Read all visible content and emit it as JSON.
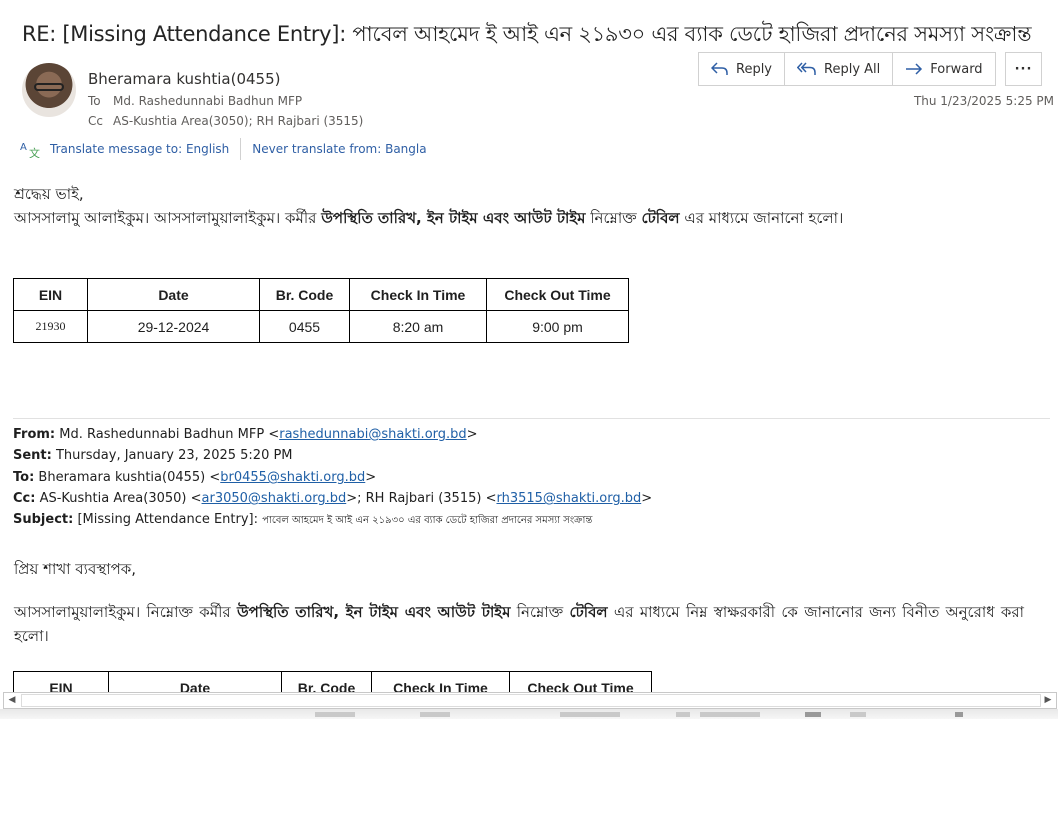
{
  "email": {
    "subject": "RE: [Missing Attendance Entry]: পাবেল আহমেদ ই আই এন ২১৯৩০ এর ব্যাক ডেটে হাজিরা প্রদানের সমস্যা সংক্রান্ত",
    "sender": "Bheramara kushtia(0455)",
    "to_label": "To",
    "to": "Md. Rashedunnabi Badhun MFP",
    "cc_label": "Cc",
    "cc": "AS-Kushtia Area(3050); RH Rajbari (3515)",
    "date": "Thu 1/23/2025 5:25 PM"
  },
  "toolbar": {
    "reply": "Reply",
    "reply_all": "Reply All",
    "forward": "Forward",
    "more": "···"
  },
  "translate": {
    "translate_link": "Translate message to: English",
    "never_link": "Never translate from: Bangla"
  },
  "body": {
    "greeting": "শ্রদ্ধেয় ভাই,",
    "para_a": "আসসালামু আলাইকুম। আসসালামুয়ালাইকুম।  কর্মীর ",
    "para_b": "উপস্থিতি তারিখ, ইন টাইম এবং আউট টাইম",
    "para_c": " নিম্নোক্ত ",
    "para_d": "টেবিল",
    "para_e": " এর মাধ্যমে জানানো হলো।",
    "table": {
      "headers": [
        "EIN",
        "Date",
        "Br. Code",
        "Check In Time",
        "Check Out Time"
      ],
      "row": [
        "21930",
        "29-12-2024",
        "0455",
        "8:20 am",
        "9:00 pm"
      ]
    }
  },
  "quoted": {
    "from_label": "From:",
    "from_name": " Md. Rashedunnabi Badhun MFP <",
    "from_email": "rashedunnabi@shakti.org.bd",
    "sent_label": "Sent:",
    "sent": " Thursday, January 23, 2025 5:20 PM",
    "to_label": "To:",
    "to_name": " Bheramara kushtia(0455) <",
    "to_email": "br0455@shakti.org.bd",
    "cc_label": "Cc:",
    "cc_name1": " AS-Kushtia Area(3050) <",
    "cc_email1": "ar3050@shakti.org.bd",
    "cc_name2": ">; RH Rajbari (3515) <",
    "cc_email2": "rh3515@shakti.org.bd",
    "subject_label": "Subject:",
    "subject_en": " [Missing Attendance Entry]: ",
    "subject_bn": "পাবেল আহমেদ ই আই এন ২১৯৩০ এর ব্যাক ডেটে হাজিরা প্রদানের সমস্যা সংক্রান্ত",
    "greeting": "প্রিয় শাখা ব্যবস্থাপক,",
    "para_a": "আসসালামুয়ালাইকুম। নিম্নোক্ত কর্মীর ",
    "para_b": "উপস্থিতি তারিখ, ইন টাইম এবং আউট টাইম",
    "para_c": " নিম্নোক্ত ",
    "para_d": "টেবিল",
    "para_e": " এর মাধ্যমে নিম্ন স্বাক্ষরকারী কে জানানোর জন্য বিনীত অনুরোধ করা হলো।",
    "table_headers": [
      "EIN",
      "Date",
      "Br. Code",
      "Check In Time",
      "Check Out Time"
    ]
  },
  "colors": {
    "link": "#1f5fa6",
    "accent": "#2f5fa5"
  }
}
